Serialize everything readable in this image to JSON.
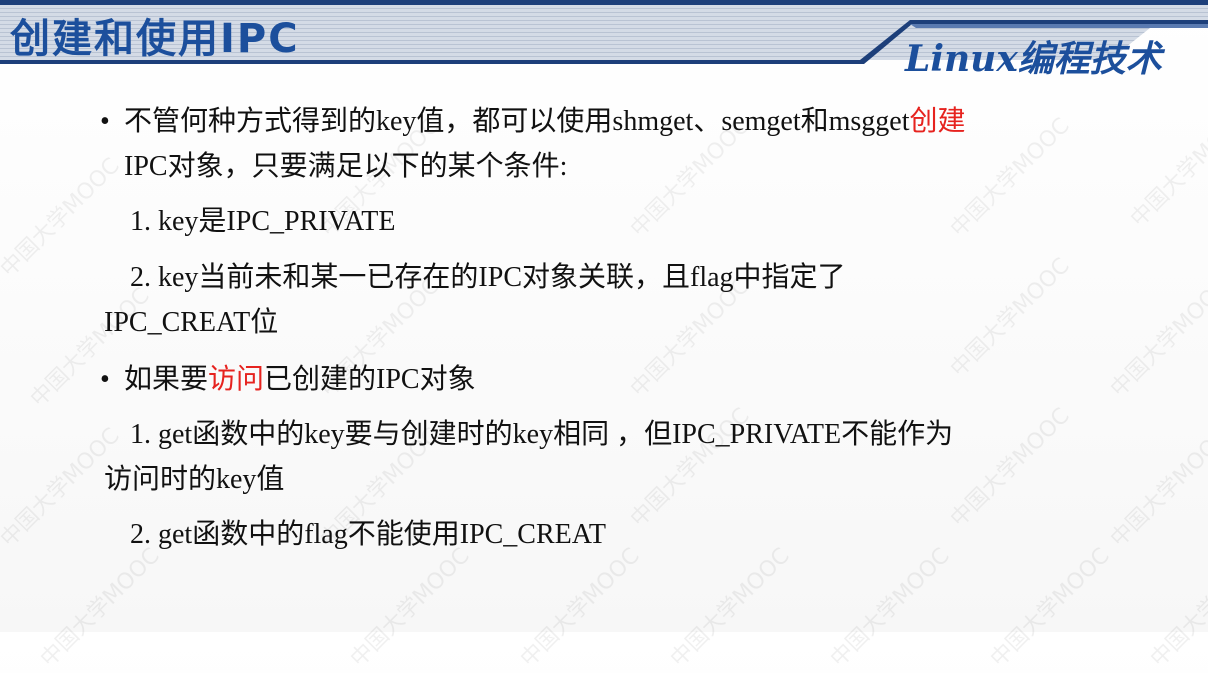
{
  "header": {
    "title": "创建和使用IPC",
    "brand": "Linux编程技术"
  },
  "body": {
    "l1_a": "不管何种方式得到的key值，都可以使用shmget、semget和msgget",
    "l1_b": "创建",
    "l2": "IPC对象，只要满足以下的某个条件:",
    "l3": "1. key是IPC_PRIVATE",
    "l4": "2. key当前未和某一已存在的IPC对象关联，且flag中指定了",
    "l5": "IPC_CREAT位",
    "l6_a": "如果要",
    "l6_b": "访问",
    "l6_c": "已创建的IPC对象",
    "l7": "1. get函数中的key要与创建时的key相同 ，但IPC_PRIVATE不能作为",
    "l8": "访问时的key值",
    "l9": "2. get函数中的flag不能使用IPC_CREAT",
    "bullet": "•"
  },
  "watermark": "中国大学MOOC",
  "colors": {
    "title": "#1c4f9c",
    "accent_red": "#e6231f",
    "band_dark": "#1d3f7a",
    "band_light": "#c9d2e0"
  }
}
